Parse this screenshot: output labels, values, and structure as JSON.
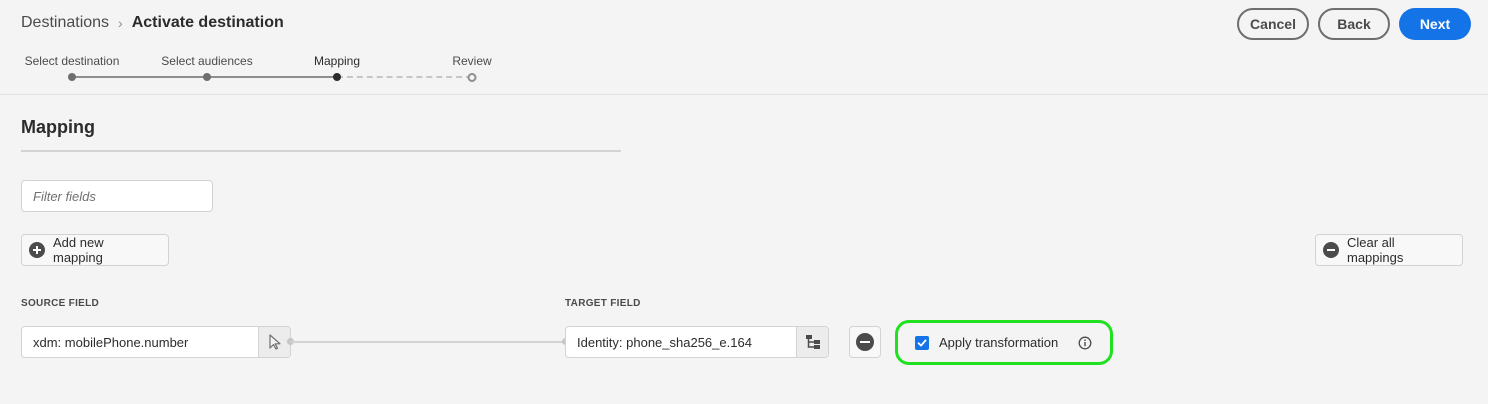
{
  "breadcrumb": {
    "root": "Destinations",
    "separator": "›",
    "current": "Activate destination"
  },
  "header_actions": {
    "cancel_label": "Cancel",
    "back_label": "Back",
    "next_label": "Next"
  },
  "stepper": {
    "steps": [
      {
        "label": "Select destination",
        "state": "done"
      },
      {
        "label": "Select audiences",
        "state": "done"
      },
      {
        "label": "Mapping",
        "state": "current"
      },
      {
        "label": "Review",
        "state": "upcoming"
      }
    ]
  },
  "mapping": {
    "title": "Mapping",
    "filter_placeholder": "Filter fields",
    "add_mapping_label": "Add new mapping",
    "clear_all_label": "Clear all mappings",
    "source_header": "SOURCE FIELD",
    "target_header": "TARGET FIELD",
    "rows": [
      {
        "source": "xdm: mobilePhone.number",
        "target": "Identity: phone_sha256_e.164",
        "apply_transformation_label": "Apply transformation",
        "apply_transformation_checked": true
      }
    ]
  },
  "colors": {
    "accent": "#1473e6",
    "highlight": "#1fe11f",
    "background": "#f4f4f4"
  },
  "icons": {
    "add": "plus-circle-icon",
    "clear": "minus-circle-icon",
    "source_select": "cursor-select-icon",
    "target_select": "schema-tree-icon",
    "remove": "minus-circle-icon",
    "info": "info-icon",
    "checkbox": "checkmark-icon"
  }
}
